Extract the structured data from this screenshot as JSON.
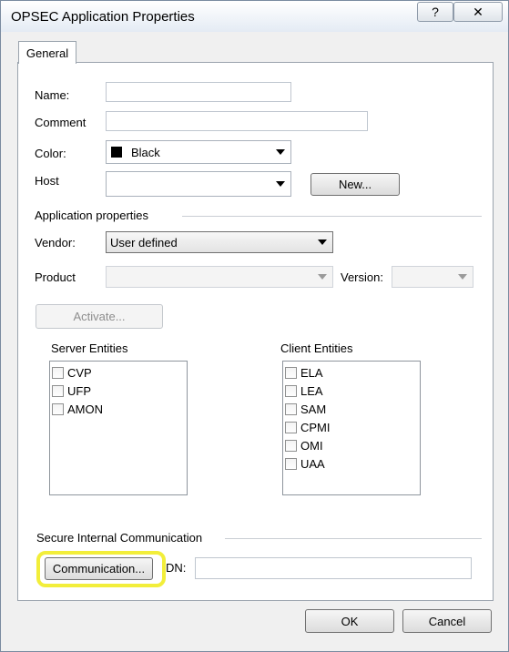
{
  "window": {
    "title": "OPSEC Application Properties",
    "help_glyph": "?",
    "close_glyph": "✕"
  },
  "tabs": [
    {
      "label": "General"
    }
  ],
  "form": {
    "name_label": "Name:",
    "name_value": "",
    "comment_label": "Comment",
    "comment_value": "",
    "color_label": "Color:",
    "color_value": "Black",
    "color_swatch": "#000000",
    "host_label": "Host",
    "host_value": "",
    "new_button": "New..."
  },
  "app_props": {
    "heading": "Application properties",
    "vendor_label": "Vendor:",
    "vendor_value": "User defined",
    "product_label": "Product",
    "product_value": "",
    "version_label": "Version:",
    "version_value": "",
    "activate_button": "Activate..."
  },
  "server_entities": {
    "heading": "Server Entities",
    "items": [
      {
        "label": "CVP",
        "checked": false
      },
      {
        "label": "UFP",
        "checked": false
      },
      {
        "label": "AMON",
        "checked": false
      }
    ]
  },
  "client_entities": {
    "heading": "Client Entities",
    "items": [
      {
        "label": "ELA",
        "checked": false
      },
      {
        "label": "LEA",
        "checked": false
      },
      {
        "label": "SAM",
        "checked": false
      },
      {
        "label": "CPMI",
        "checked": false
      },
      {
        "label": "OMI",
        "checked": false
      },
      {
        "label": "UAA",
        "checked": false
      }
    ]
  },
  "sic": {
    "heading": "Secure Internal Communication",
    "communication_button": "Communication...",
    "dn_label": "DN:",
    "dn_value": ""
  },
  "footer": {
    "ok_button": "OK",
    "cancel_button": "Cancel"
  },
  "colors": {
    "highlight": "#f2ee3a"
  }
}
